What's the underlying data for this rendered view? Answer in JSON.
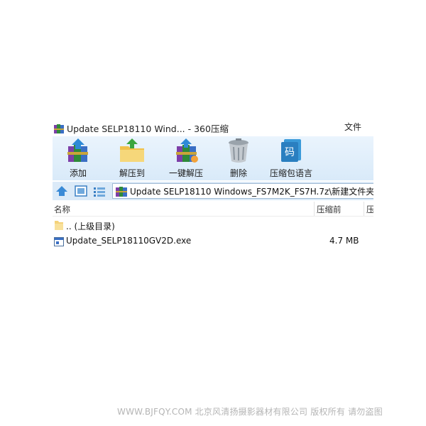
{
  "window": {
    "title": "Update SELP18110 Wind... - 360压缩",
    "menu_file": "文件"
  },
  "toolbar": {
    "items": [
      {
        "label": "添加",
        "icon": "add-archive-icon"
      },
      {
        "label": "解压到",
        "icon": "extract-to-folder-icon"
      },
      {
        "label": "一键解压",
        "icon": "one-click-extract-icon"
      },
      {
        "label": "删除",
        "icon": "trash-can-icon"
      },
      {
        "label": "压缩包语言",
        "icon": "archive-language-icon"
      }
    ],
    "language_icon_glyph": "码"
  },
  "address": {
    "path": "Update SELP18110 Windows_FS7M2K_FS7H.7z\\新建文件夹 -"
  },
  "columns": {
    "name": "名称",
    "compressed_before": "压缩前",
    "compressed_after": "压"
  },
  "files": [
    {
      "name": ".. (上级目录)",
      "size": "",
      "icon": "folder-icon"
    },
    {
      "name": "Update_SELP18110GV2D.exe",
      "size": "4.7 MB",
      "icon": "exe-file-icon"
    }
  ],
  "watermark": "WWW.BJFQY.COM 北京风清扬摄影器材有限公司 版权所有 请勿盗图",
  "colors": {
    "toolbar_bg": "#dcebf9",
    "address_bar_bg": "#dbeaf8",
    "folder_yellow": "#f4d27a",
    "accent_blue": "#3a7fc4"
  }
}
